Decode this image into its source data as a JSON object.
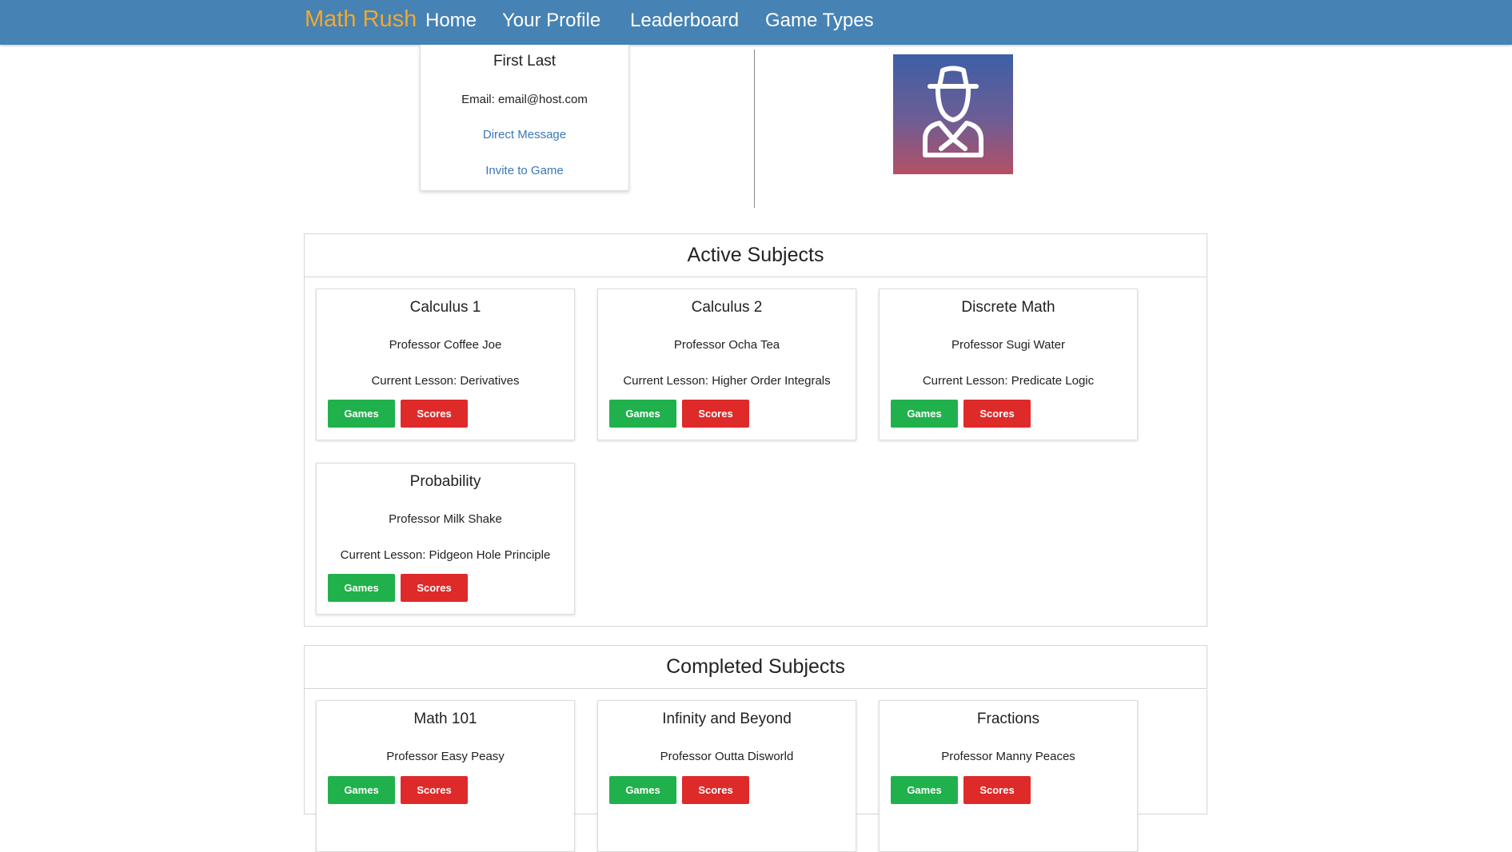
{
  "nav": {
    "brand": "Math Rush",
    "links": [
      "Home",
      "Your Profile",
      "Leaderboard",
      "Game Types"
    ]
  },
  "profile": {
    "name": "First Last",
    "email": "Email: email@host.com",
    "direct_message": "Direct Message",
    "invite": "Invite to Game",
    "avatar_icon": "detective-user-icon"
  },
  "active": {
    "title": "Active Subjects",
    "subjects": [
      {
        "title": "Calculus 1",
        "professor": "Professor Coffee Joe",
        "lesson": "Current Lesson: Derivatives",
        "games": "Games",
        "scores": "Scores"
      },
      {
        "title": "Calculus 2",
        "professor": "Professor Ocha Tea",
        "lesson": "Current Lesson: Higher Order Integrals",
        "games": "Games",
        "scores": "Scores"
      },
      {
        "title": "Discrete Math",
        "professor": "Professor Sugi Water",
        "lesson": "Current Lesson: Predicate Logic",
        "games": "Games",
        "scores": "Scores"
      },
      {
        "title": "Probability",
        "professor": "Professor Milk Shake",
        "lesson": "Current Lesson: Pidgeon Hole Principle",
        "games": "Games",
        "scores": "Scores"
      }
    ]
  },
  "completed": {
    "title": "Completed Subjects",
    "subjects": [
      {
        "title": "Math 101",
        "professor": "Professor Easy Peasy",
        "games": "Games",
        "scores": "Scores"
      },
      {
        "title": "Infinity and Beyond",
        "professor": "Professor Outta Disworld",
        "games": "Games",
        "scores": "Scores"
      },
      {
        "title": "Fractions",
        "professor": "Professor Manny Peaces",
        "games": "Games",
        "scores": "Scores"
      }
    ]
  },
  "colors": {
    "navbar": "#4682b4",
    "brand": "#f0a830",
    "games_button": "#21b14c",
    "scores_button": "#df2a2a",
    "link": "#3a78b8"
  }
}
